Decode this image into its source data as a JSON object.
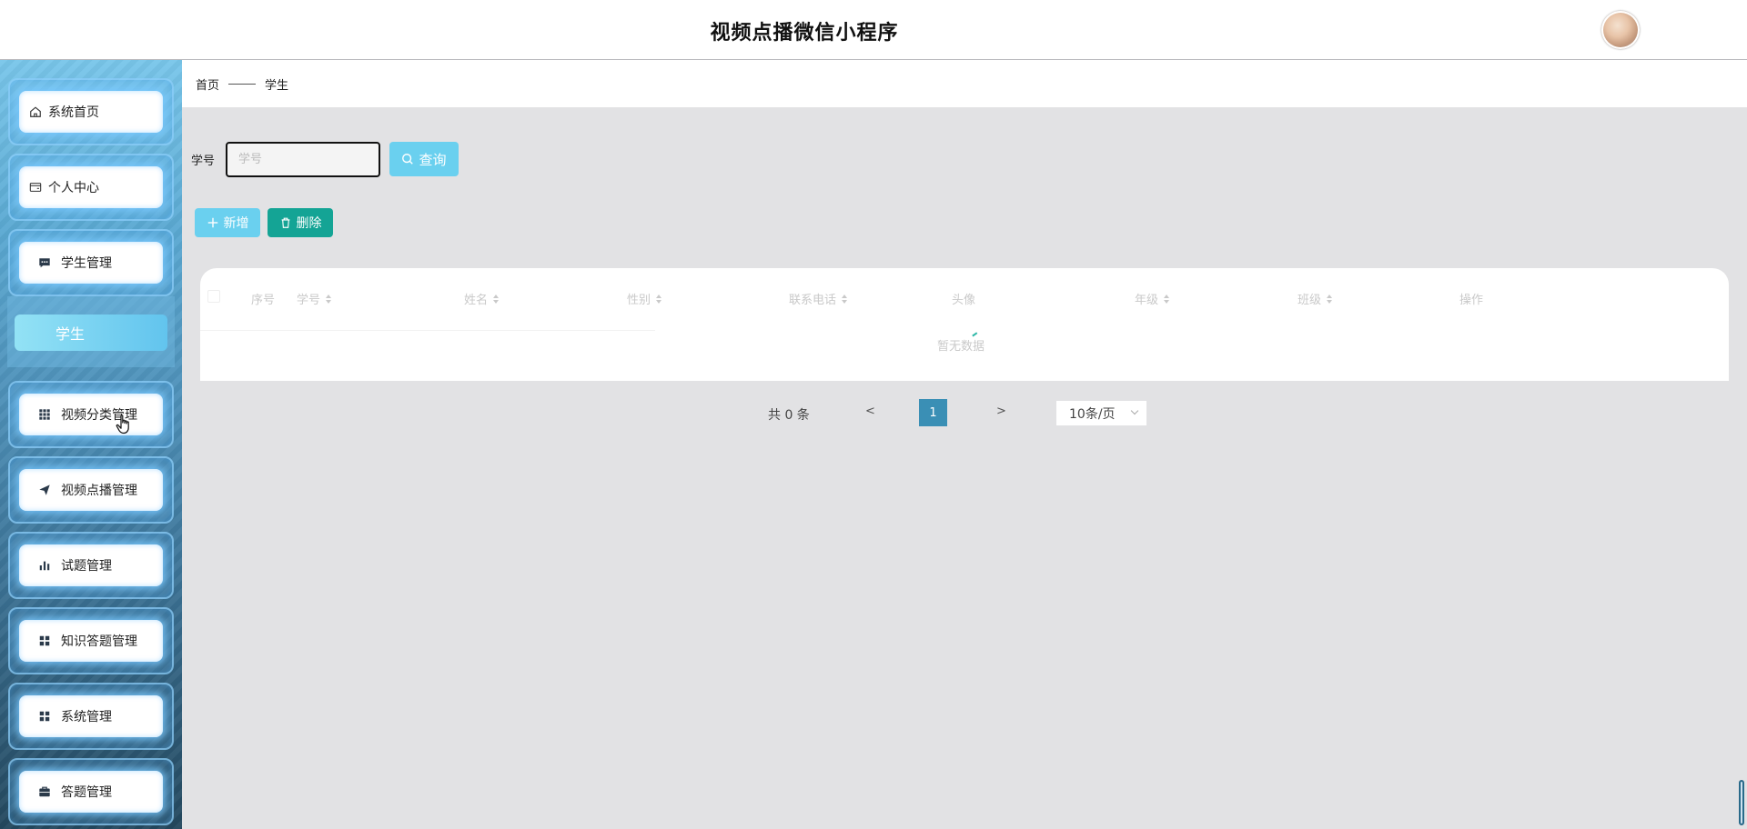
{
  "header": {
    "title": "视频点播微信小程序"
  },
  "sidebar": {
    "items": [
      {
        "label": "系统首页",
        "icon": "home-icon"
      },
      {
        "label": "个人中心",
        "icon": "wallet-icon"
      },
      {
        "label": "学生管理",
        "icon": "chat-icon"
      },
      {
        "label": "视频分类管理",
        "icon": "grid-icon"
      },
      {
        "label": "视频点播管理",
        "icon": "send-icon"
      },
      {
        "label": "试题管理",
        "icon": "bar-chart-icon"
      },
      {
        "label": "知识答题管理",
        "icon": "apps-icon"
      },
      {
        "label": "系统管理",
        "icon": "apps-icon"
      },
      {
        "label": "答题管理",
        "icon": "briefcase-icon"
      }
    ],
    "submenu": {
      "label": "学生"
    }
  },
  "breadcrumb": {
    "home": "首页",
    "current": "学生"
  },
  "search": {
    "label": "学号",
    "placeholder": "学号",
    "value": "",
    "query_label": "查询"
  },
  "toolbar": {
    "add_label": "新增",
    "delete_label": "删除"
  },
  "table": {
    "columns": [
      "序号",
      "学号",
      "姓名",
      "性别",
      "联系电话",
      "头像",
      "年级",
      "班级",
      "操作"
    ],
    "empty_text": "暂无数据"
  },
  "pagination": {
    "total_text": "共 0 条",
    "prev": "<",
    "next": ">",
    "current_page": "1",
    "page_size": "10条/页"
  },
  "colors": {
    "accent": "#6ad0ef",
    "danger_teal": "#14a495",
    "page_active": "#3a8fb5"
  }
}
